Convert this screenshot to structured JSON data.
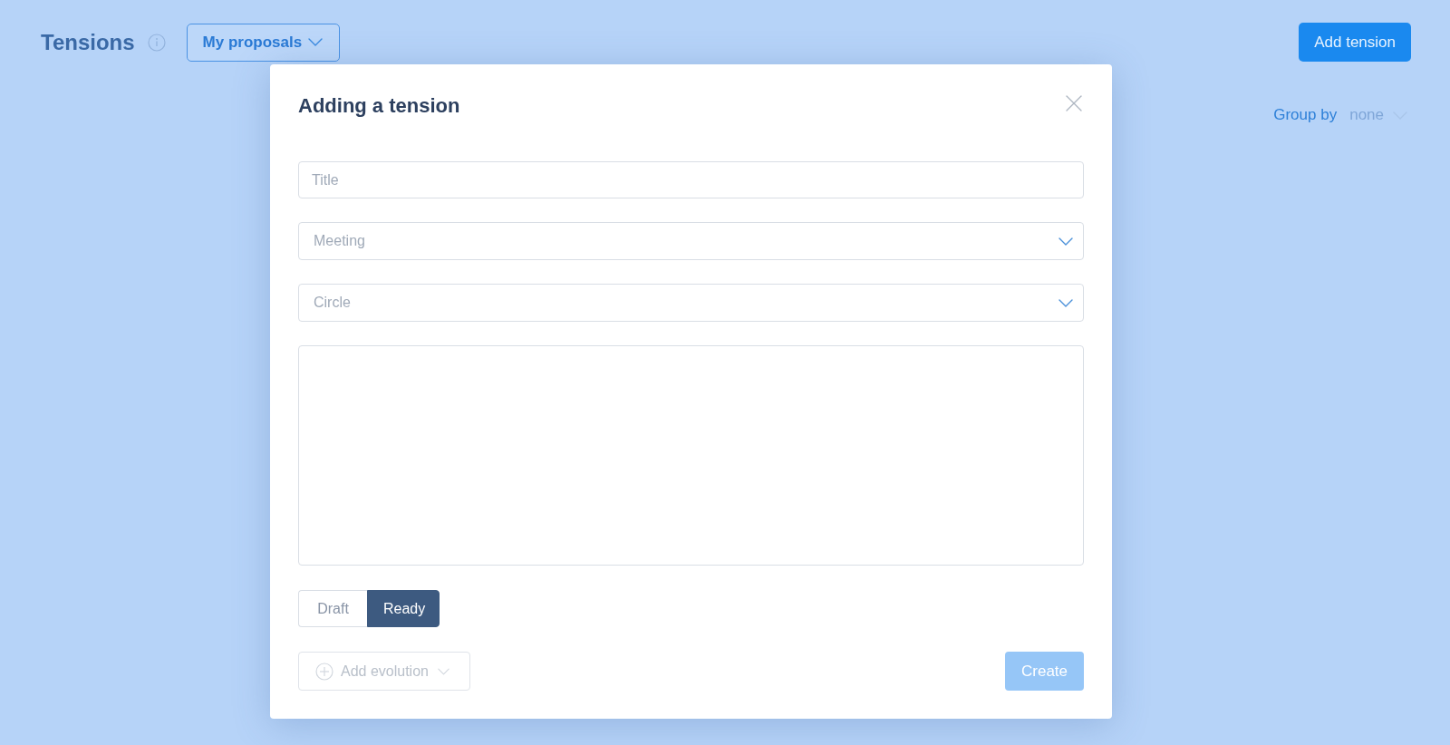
{
  "header": {
    "title": "Tensions",
    "filter": {
      "label": "My proposals"
    },
    "add_button": {
      "label": "Add tension"
    }
  },
  "group_by": {
    "label": "Group by",
    "value": "none",
    "disabled": true
  },
  "modal": {
    "title": "Adding a tension",
    "fields": [
      {
        "kind": "text",
        "placeholder": "Title"
      },
      {
        "kind": "select",
        "placeholder": "Meeting"
      },
      {
        "kind": "select",
        "placeholder": "Circle"
      },
      {
        "kind": "textarea"
      }
    ],
    "status_toggle": [
      {
        "label": "Draft",
        "selected": false
      },
      {
        "label": "Ready",
        "selected": true
      }
    ],
    "add_evolution": {
      "label": "Add evolution",
      "disabled": true
    },
    "create_button": {
      "label": "Create",
      "disabled": true
    }
  }
}
